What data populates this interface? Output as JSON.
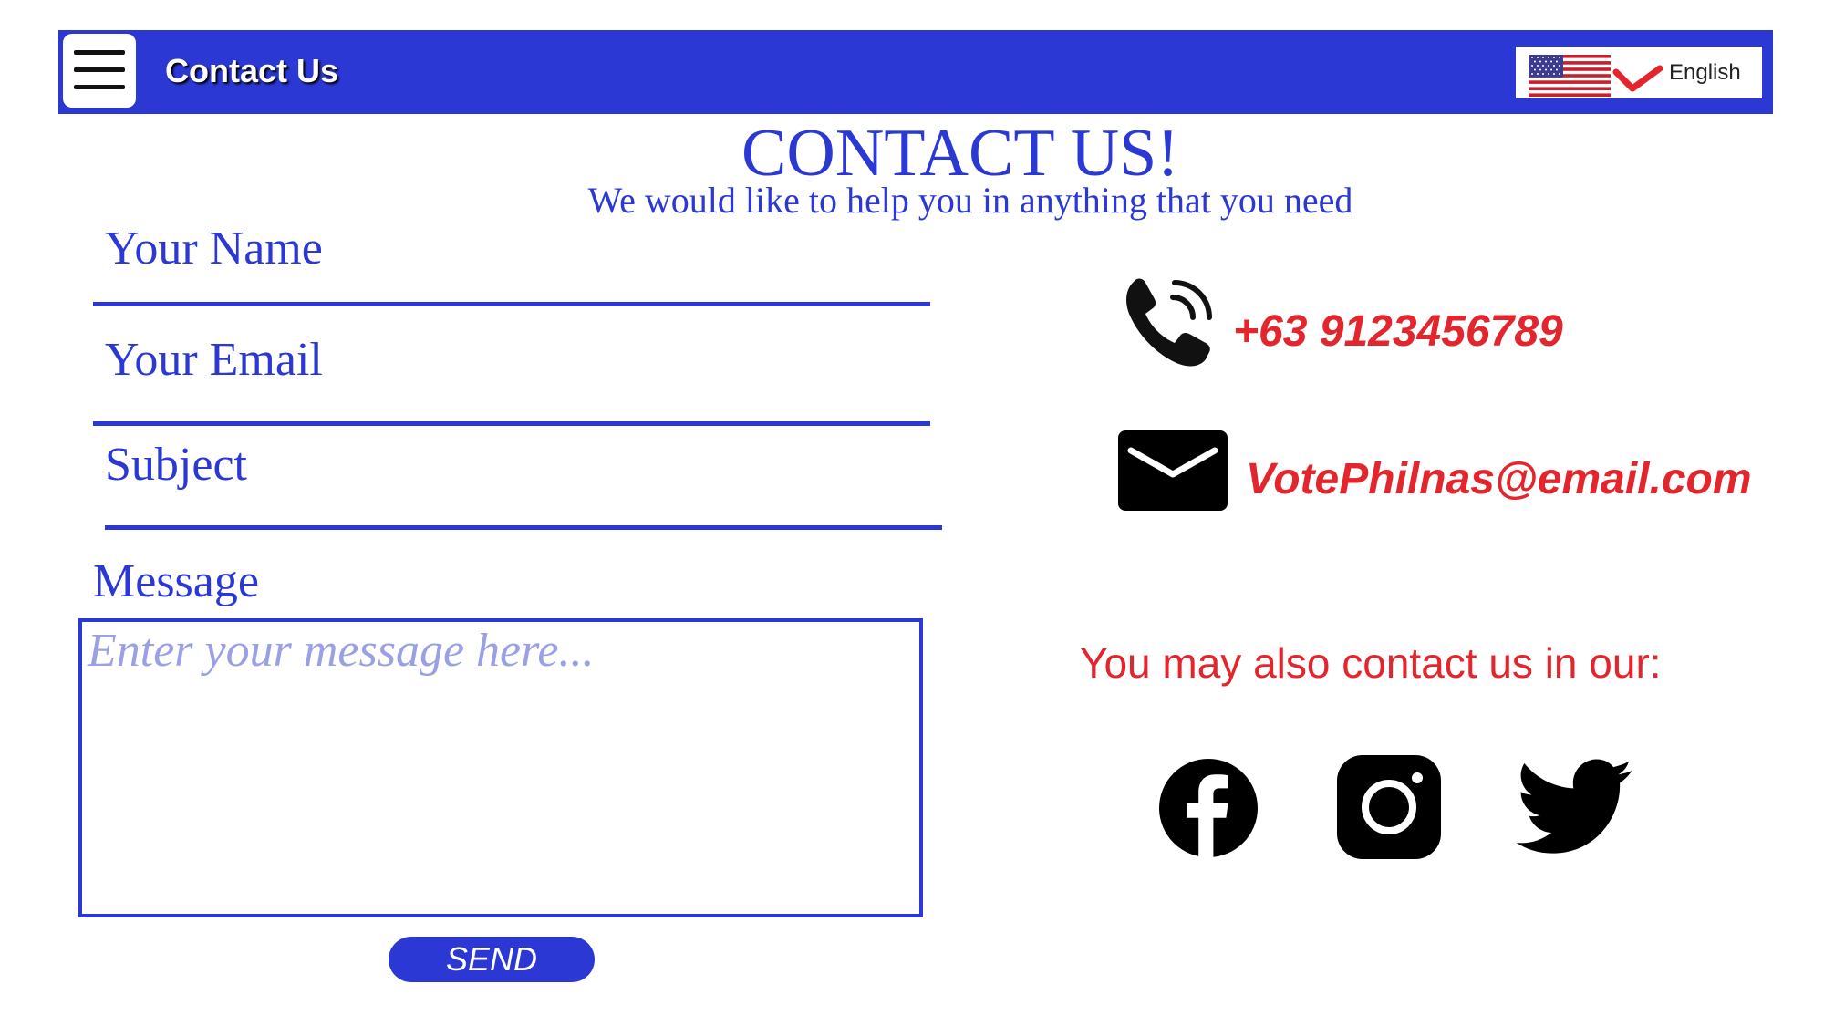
{
  "header": {
    "title": "Contact Us",
    "menu_icon": "hamburger-menu-icon",
    "language": {
      "label": "English",
      "flag_icon": "us-flag-icon",
      "chevron_icon": "chevron-down-icon"
    }
  },
  "main": {
    "title": "CONTACT US!",
    "subtitle": "We would like to help you in anything that you need"
  },
  "form": {
    "name_label": "Your Name",
    "email_label": "Your Email",
    "subject_label": "Subject",
    "message_label": "Message",
    "message_placeholder": "Enter your message here...",
    "send_label": "SEND"
  },
  "contact": {
    "phone_icon": "phone-icon",
    "phone": "+63 9123456789",
    "email_icon": "envelope-icon",
    "email": "VotePhilnas@email.com",
    "social_heading": "You may also contact us in our:",
    "social": [
      {
        "icon": "facebook-icon"
      },
      {
        "icon": "instagram-icon"
      },
      {
        "icon": "twitter-icon"
      }
    ]
  },
  "colors": {
    "primary_blue": "#2b38d4",
    "accent_red": "#e3262d",
    "white": "#ffffff",
    "black": "#000000"
  }
}
